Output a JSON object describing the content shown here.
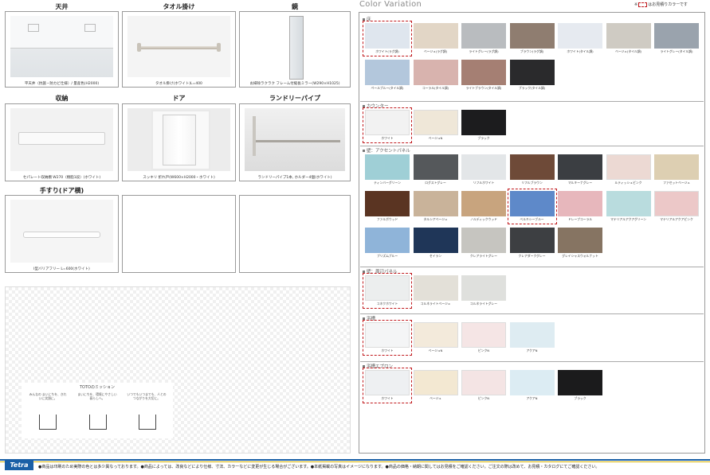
{
  "equipment": [
    {
      "title": "天井",
      "caption": "平天井（抗菌・防カビ仕様）/ 量産色(H2000)"
    },
    {
      "title": "タオル掛け",
      "caption": "タオル掛け(ホワイト)L=400"
    },
    {
      "title": "鏡",
      "caption": "お掃除ラクラク フレーム付縦長ミラー(W290×H1025)"
    },
    {
      "title": "収納",
      "caption": "セパレート収納棚 W270（樹脂1段）(ホワイト)"
    },
    {
      "title": "ドア",
      "caption": "スッキリ 折れ戸(W600×H2000・ホワイト)"
    },
    {
      "title": "ランドリーパイプ",
      "caption": "ランドリーパイプ1本, ホルダー4個(ホワイト)"
    },
    {
      "title": "手すり(ドア横)",
      "caption": "I型バリアフリー L=600(ホワイト)"
    }
  ],
  "mission": {
    "title": "TOTOのミッション",
    "items": [
      "みんなの まいにちを、きれいに笑顔に。",
      "まいにちを、環境にやさしい暮らしへ。",
      "いつでもいつまでも、人とのつながりを大切に。"
    ]
  },
  "color_variation": {
    "title": "Color Variation",
    "note_prefix": "※",
    "note_suffix": "はお見積りカラーです",
    "sections": [
      {
        "name": "床",
        "items": [
          {
            "label": "ホワイト(ラグ調)",
            "color": "#dfe6ee",
            "sel": true
          },
          {
            "label": "ベージュ(ラグ調)",
            "color": "#e2d6c6"
          },
          {
            "label": "ライトグレー(ラグ調)",
            "color": "#b9bcbf"
          },
          {
            "label": "ブラウン(ラグ調)",
            "color": "#8f7d70"
          },
          {
            "label": "ホワイト(タイル調)",
            "color": "#e6eaf0"
          },
          {
            "label": "ベージュ(タイル調)",
            "color": "#cfcbc3"
          },
          {
            "label": "ライトグレー(タイル調)",
            "color": "#9aa3ad"
          },
          {
            "label": "ペールブルー(タイル調)",
            "color": "#b3c7dc"
          },
          {
            "label": "コーラル(タイル調)",
            "color": "#d8b3ae"
          },
          {
            "label": "ライトブラウン(タイル調)",
            "color": "#a57f73"
          },
          {
            "label": "ブラック(タイル調)",
            "color": "#2a2a2c"
          }
        ]
      },
      {
        "name": "カウンター",
        "items": [
          {
            "label": "ホワイト",
            "color": "#f2f2f2",
            "sel": true
          },
          {
            "label": "ベージュN",
            "color": "#efe7d8"
          },
          {
            "label": "ブラック",
            "color": "#1c1c1e"
          }
        ]
      },
      {
        "name": "壁：アクセントパネル",
        "items": [
          {
            "label": "ティンバーグリーン",
            "color": "#9fcfd6"
          },
          {
            "label": "ログストグレー",
            "color": "#55585b"
          },
          {
            "label": "リフルホワイト",
            "color": "#e3e6e8"
          },
          {
            "label": "リフルブラウン",
            "color": "#6e4a38"
          },
          {
            "label": "マルキーナグレー",
            "color": "#3b3e42"
          },
          {
            "label": "ルティッシュピンク",
            "color": "#ecd9d3"
          },
          {
            "label": "ファセットベージュ",
            "color": "#ddcfb2"
          },
          {
            "label": "ファルボウッド",
            "color": "#5a3422"
          },
          {
            "label": "タルシアベージュ",
            "color": "#c9b39a"
          },
          {
            "label": "ノルディックウッド",
            "color": "#c8a47e"
          },
          {
            "label": "ベルキシーブルー",
            "color": "#5e89c9",
            "sel": true
          },
          {
            "label": "ドレープコーラル",
            "color": "#e7b7bc"
          },
          {
            "label": "マテリアルアクアグリーン",
            "color": "#b9dcde"
          },
          {
            "label": "マテリアルアクアピンク",
            "color": "#ecc8c8"
          },
          {
            "label": "プリズムブルー",
            "color": "#8fb4d9"
          },
          {
            "label": "セイラン",
            "color": "#1f3658"
          },
          {
            "label": "クレアライトグレー",
            "color": "#c6c5c0"
          },
          {
            "label": "クレアダークグレー",
            "color": "#3d3f42"
          },
          {
            "label": "グレイシャスウォルナット",
            "color": "#867462"
          }
        ]
      },
      {
        "name": "壁：周辺パネル",
        "items": [
          {
            "label": "コネクホワイト",
            "color": "#eceeee",
            "sel": true
          },
          {
            "label": "コルネライトベージュ",
            "color": "#e3e0d8"
          },
          {
            "label": "コルネライトグレー",
            "color": "#dfe0dd"
          }
        ]
      },
      {
        "name": "浴槽",
        "items": [
          {
            "label": "ホワイト",
            "color": "#f4f5f6",
            "sel": true
          },
          {
            "label": "ベージュN",
            "color": "#f3eadb"
          },
          {
            "label": "ピンクN",
            "color": "#f5e5e5"
          },
          {
            "label": "アクアN",
            "color": "#deecf2"
          }
        ]
      },
      {
        "name": "浴槽エプロン",
        "items": [
          {
            "label": "ホワイト",
            "color": "#eef0f2",
            "sel": true
          },
          {
            "label": "ベージュ",
            "color": "#f3e8d2"
          },
          {
            "label": "ピンクN",
            "color": "#f4e4e4"
          },
          {
            "label": "アクアN",
            "color": "#dcecf3"
          },
          {
            "label": "ブラック",
            "color": "#1b1b1c"
          }
        ]
      }
    ]
  },
  "footer": {
    "logo": "Tetra",
    "disclaimer": "●商品は印刷のため実際の色とは多少異なっております。●商品によっては、改良などにより仕様、寸法、カラーなどに変更が生じる場合がございます。●本紙掲載の写真はイメージになります。●商品の価格・納期に関してはお見積をご確認ください。ご注文の際は改めて、お見積・カタログにてご確認ください。"
  },
  "colors": {
    "accent_red": "#c0171b",
    "brand_blue": "#1a5fa6",
    "brand_yellow": "#d8b300"
  }
}
